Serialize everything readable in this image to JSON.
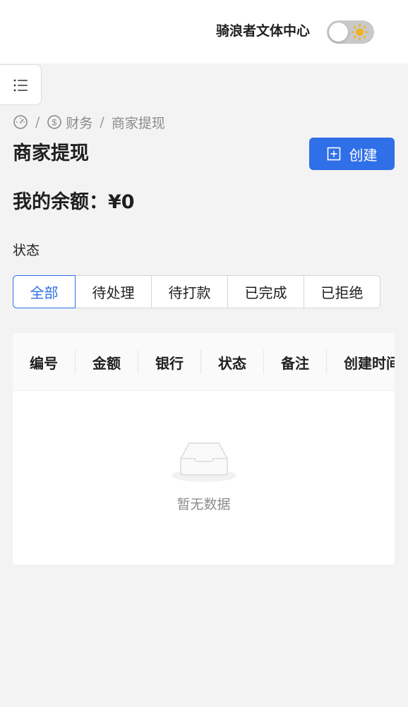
{
  "header": {
    "site_title": "骑浪者文体中心",
    "theme_toggle_icon": "sun-icon"
  },
  "sidebar_toggle": {
    "icon": "list-icon"
  },
  "breadcrumb": {
    "home_icon": "dashboard-icon",
    "separator": "/",
    "finance_icon": "dollar-icon",
    "finance_label": "财务",
    "current_label": "商家提现"
  },
  "page": {
    "title": "商家提现",
    "create_label": "创建",
    "create_icon": "plus-square-icon",
    "balance_label": "我的余额：",
    "balance_value": "¥0"
  },
  "filter": {
    "label": "状态",
    "tabs": [
      {
        "label": "全部",
        "active": true
      },
      {
        "label": "待处理",
        "active": false
      },
      {
        "label": "待打款",
        "active": false
      },
      {
        "label": "已完成",
        "active": false
      },
      {
        "label": "已拒绝",
        "active": false
      }
    ]
  },
  "table": {
    "columns": [
      "编号",
      "金额",
      "银行",
      "状态",
      "备注",
      "创建时间"
    ],
    "empty_text": "暂无数据",
    "empty_icon": "empty-inbox-icon"
  },
  "colors": {
    "primary": "#2f6fe8",
    "background": "#f3f3f3"
  }
}
